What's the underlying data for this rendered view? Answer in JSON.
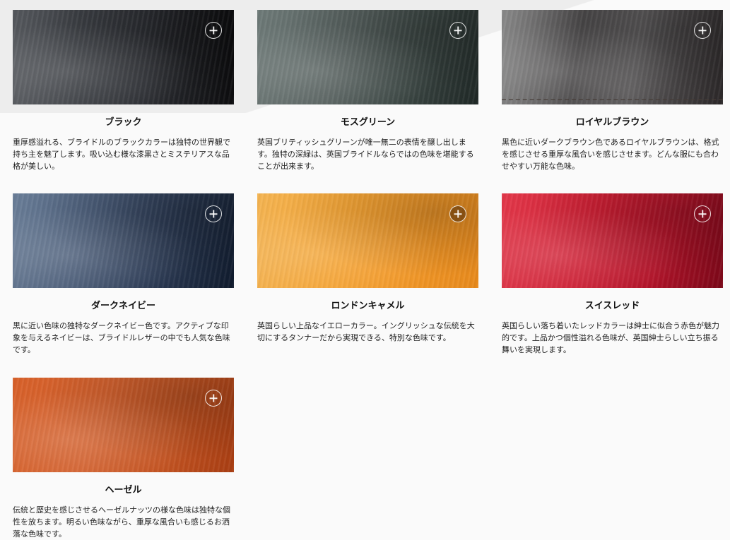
{
  "colors": [
    {
      "id": "black",
      "title": "ブラック",
      "description": "重厚感溢れる、ブライドルのブラックカラーは独特の世界観で持ち主を魅了します。吸い込む様な漆黒さとミステリアスな品格が美しい。",
      "hex": "#2c2e33"
    },
    {
      "id": "moss",
      "title": "モスグリーン",
      "description": "英国ブリティッシュグリーンが唯一無二の表情を醸し出します。独特の深緑は、英国ブライドルならではの色味を堪能することが出来ます。",
      "hex": "#56605e"
    },
    {
      "id": "brown",
      "title": "ロイヤルブラウン",
      "description": "黒色に近いダークブラウン色であるロイヤルブラウンは、格式を感じさせる重厚な風合いを感じさせます。どんな服にも合わせやすい万能な色味。",
      "hex": "#4a4849"
    },
    {
      "id": "navy",
      "title": "ダークネイビー",
      "description": "黒に近い色味の独特なダークネイビー色です。アクティブな印象を与えるネイビーは、ブライドルレザーの中でも人気な色味です。",
      "hex": "#2e3d57"
    },
    {
      "id": "camel",
      "title": "ロンドンキャメル",
      "description": "英国らしい上品なイエローカラー。イングリッシュな伝統を大切にするタンナーだから実現できる、特別な色味です。",
      "hex": "#f6a535"
    },
    {
      "id": "red",
      "title": "スイスレッド",
      "description": "英国らしい落ち着いたレッドカラーは紳士に似合う赤色が魅力的です。上品かつ個性溢れる色味が、英国紳士らしい立ち振る舞いを実現します。",
      "hex": "#cf1f34"
    },
    {
      "id": "hazel",
      "title": "ヘーゼル",
      "description": "伝統と歴史を感じさせるヘーゼルナッツの様な色味は独特な個性を放ちます。明るい色味ながら、重厚な風合いも感じるお洒落な色味です。",
      "hex": "#d4622f"
    }
  ],
  "icons": {
    "expand": "plus-circle-icon"
  }
}
